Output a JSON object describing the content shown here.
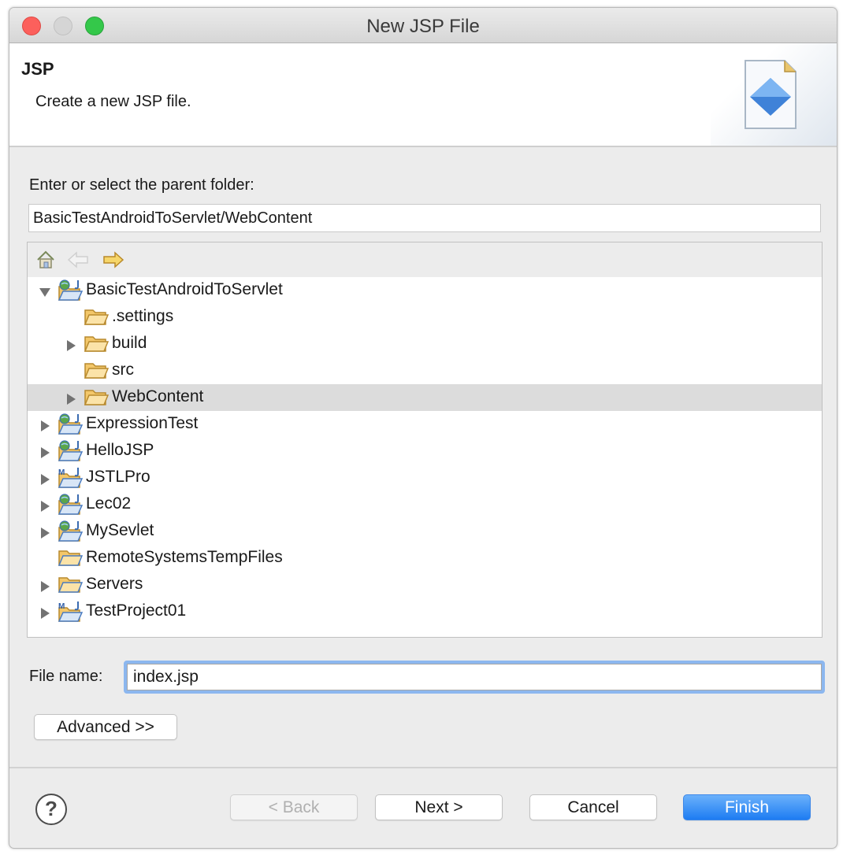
{
  "window": {
    "title": "New JSP File"
  },
  "banner": {
    "title": "JSP",
    "description": "Create a new JSP file."
  },
  "parent_folder": {
    "label": "Enter or select the parent folder:",
    "value": "BasicTestAndroidToServlet/WebContent"
  },
  "tree": {
    "toolbar": [
      "home-icon",
      "back-arrow-icon",
      "forward-arrow-icon"
    ],
    "items": [
      {
        "label": "BasicTestAndroidToServlet",
        "level": 0,
        "expanded": true,
        "icon": "web-project-icon"
      },
      {
        "label": ".settings",
        "level": 1,
        "icon": "folder-icon"
      },
      {
        "label": "build",
        "level": 1,
        "expandable": true,
        "icon": "folder-icon"
      },
      {
        "label": "src",
        "level": 1,
        "icon": "folder-icon"
      },
      {
        "label": "WebContent",
        "level": 1,
        "expandable": true,
        "selected": true,
        "icon": "folder-icon"
      },
      {
        "label": "ExpressionTest",
        "level": 0,
        "expandable": true,
        "icon": "web-project-icon"
      },
      {
        "label": "HelloJSP",
        "level": 0,
        "expandable": true,
        "icon": "web-project-icon"
      },
      {
        "label": "JSTLPro",
        "level": 0,
        "expandable": true,
        "icon": "maven-project-icon"
      },
      {
        "label": "Lec02",
        "level": 0,
        "expandable": true,
        "icon": "web-project-icon"
      },
      {
        "label": "MySevlet",
        "level": 0,
        "expandable": true,
        "icon": "web-project-icon"
      },
      {
        "label": "RemoteSystemsTempFiles",
        "level": 0,
        "icon": "project-folder-icon"
      },
      {
        "label": "Servers",
        "level": 0,
        "expandable": true,
        "icon": "project-folder-icon"
      },
      {
        "label": "TestProject01",
        "level": 0,
        "expandable": true,
        "icon": "maven-project-icon"
      }
    ]
  },
  "file_name": {
    "label": "File name:",
    "value": "index.jsp"
  },
  "buttons": {
    "advanced": "Advanced >>",
    "back": "< Back",
    "next": "Next >",
    "cancel": "Cancel",
    "finish": "Finish",
    "help": "?"
  },
  "colors": {
    "accent": "#1d7cf2",
    "selection": "#dcdcdc",
    "focus_ring": "#8cb7ef"
  }
}
